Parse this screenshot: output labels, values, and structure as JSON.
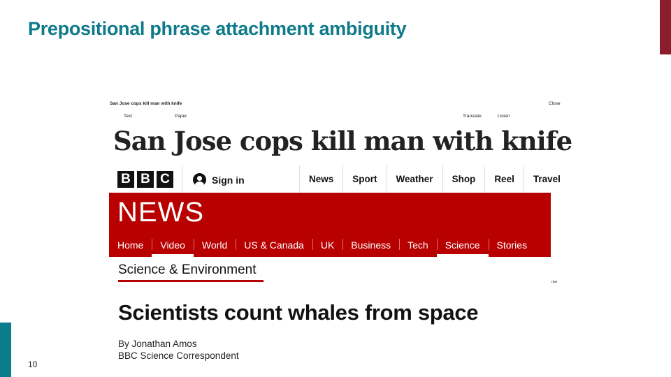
{
  "slide": {
    "title": "Prepositional phrase attachment ambiguity",
    "page_number": "10"
  },
  "clipping": {
    "small_headline": "San Jose cops kill man with knife",
    "close_label": "Close",
    "text_label": "Text",
    "paper_label": "Paper",
    "translate_label": "Translate",
    "listen_label": "Listen",
    "headline": "San Jose cops kill man with knife",
    "side_fragment": "nue"
  },
  "bbc": {
    "logo_letters": [
      "B",
      "B",
      "C"
    ],
    "sign_in_label": "Sign in",
    "top_nav": [
      "News",
      "Sport",
      "Weather",
      "Shop",
      "Reel",
      "Travel"
    ],
    "news_word": "NEWS",
    "news_nav": [
      "Home",
      "Video",
      "World",
      "US & Canada",
      "UK",
      "Business",
      "Tech",
      "Science",
      "Stories"
    ],
    "section_title": "Science & Environment",
    "article_headline": "Scientists count whales from space",
    "byline_name": "By Jonathan Amos",
    "byline_role": "BBC Science Correspondent",
    "colors": {
      "brand_red": "#b80000",
      "title_teal": "#0f7a8a",
      "accent_maroon": "#8b1d2c"
    }
  }
}
